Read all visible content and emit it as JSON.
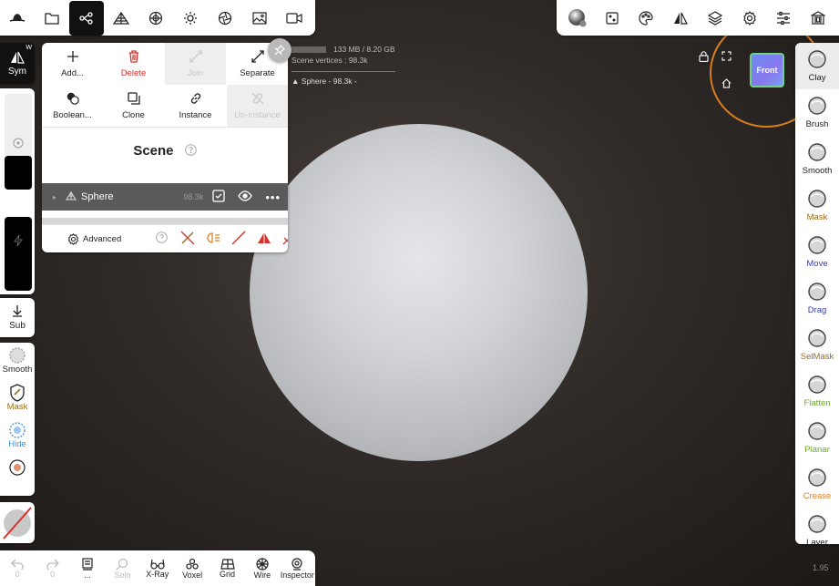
{
  "colors": {
    "accent": "#111111",
    "delete": "#d9302c",
    "move": "#3b3fa8",
    "flatten": "#6aa52e",
    "crease": "#d9822b",
    "hide": "#3e8fd6",
    "mask": "#9a6a1c",
    "orbit": "#d97f20"
  },
  "top_left_toolbar": [
    "hat-icon",
    "folder-icon",
    "scene-graph-icon",
    "topology-icon",
    "material-icon",
    "light-icon",
    "camera-aperture-icon",
    "image-icon",
    "video-icon"
  ],
  "top_right_toolbar": [
    "matcap-icon",
    "dots-icon",
    "palette-icon",
    "symmetry-icon",
    "layers-icon",
    "gear-icon",
    "sliders-icon",
    "museum-icon"
  ],
  "left": {
    "sym_label": "Sym",
    "sym_badge": "W",
    "sub_label": "Sub",
    "tools": [
      {
        "label": "Smooth",
        "icon": "smooth-icon"
      },
      {
        "label": "Mask",
        "icon": "mask-icon"
      },
      {
        "label": "Hide",
        "icon": "hide-icon"
      },
      {
        "label": "",
        "icon": "lasso-icon"
      }
    ]
  },
  "scene_panel": {
    "buttons": [
      {
        "label": "Add...",
        "icon": "plus-icon",
        "state": "normal"
      },
      {
        "label": "Delete",
        "icon": "trash-icon",
        "state": "delete"
      },
      {
        "label": "Join",
        "icon": "join-icon",
        "state": "disabled"
      },
      {
        "label": "Separate",
        "icon": "separate-icon",
        "state": "normal"
      },
      {
        "label": "Boolean...",
        "icon": "boolean-icon",
        "state": "normal"
      },
      {
        "label": "Clone",
        "icon": "clone-icon",
        "state": "normal"
      },
      {
        "label": "Instance",
        "icon": "link-icon",
        "state": "normal"
      },
      {
        "label": "Un-instance",
        "icon": "unlink-icon",
        "state": "disabled"
      }
    ],
    "title": "Scene",
    "row": {
      "name": "Sphere",
      "count": "98.3k"
    },
    "advanced_label": "Advanced"
  },
  "stats": {
    "memory": "133 MB / 8.20 GB",
    "vertices": "Scene vertices : 98.3k",
    "object": "Sphere - 98.3k -"
  },
  "viewcube_label": "Front",
  "right_tools": [
    {
      "label": "Clay",
      "color": "#222222",
      "active": true
    },
    {
      "label": "Brush",
      "color": "#222222"
    },
    {
      "label": "Smooth",
      "color": "#222222"
    },
    {
      "label": "Mask",
      "color": "#9a6a1c"
    },
    {
      "label": "Move",
      "color": "#3b3fa8"
    },
    {
      "label": "Drag",
      "color": "#3b3fa8"
    },
    {
      "label": "SelMask",
      "color": "#9a6a1c"
    },
    {
      "label": "Flatten",
      "color": "#6aa52e"
    },
    {
      "label": "Planar",
      "color": "#6aa52e"
    },
    {
      "label": "Crease",
      "color": "#d9822b"
    },
    {
      "label": "Layer",
      "color": "#222222"
    }
  ],
  "bottom": [
    {
      "label": "0",
      "icon": "undo-icon",
      "dim": true
    },
    {
      "label": "0",
      "icon": "redo-icon",
      "dim": true
    },
    {
      "label": "...",
      "icon": "book-icon",
      "dim": false
    },
    {
      "label": "Solo",
      "icon": "search-icon",
      "dim": true
    },
    {
      "label": "X-Ray",
      "icon": "glasses-icon",
      "dim": false
    },
    {
      "label": "Voxel",
      "icon": "voxel-icon",
      "dim": false
    },
    {
      "label": "Grid",
      "icon": "grid-icon",
      "dim": false
    },
    {
      "label": "Wire",
      "icon": "wire-icon",
      "dim": false
    },
    {
      "label": "Inspector",
      "icon": "inspector-icon",
      "dim": false
    }
  ],
  "zoom": "1.95"
}
